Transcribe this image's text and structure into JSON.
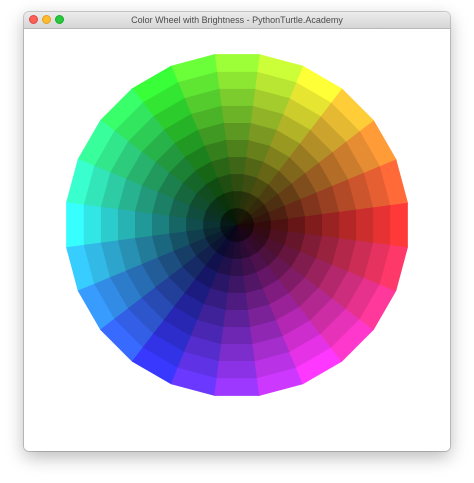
{
  "window": {
    "title": "Color Wheel with Brightness - PythonTurtle.Academy"
  },
  "title_bar_controls": {
    "close": "close-button",
    "minimize": "minimize-button",
    "maximize": "zoom-button"
  },
  "wheel": {
    "hue_segments": 24,
    "brightness_rings": 10,
    "center_color": "#000000",
    "hue_order": [
      "red",
      "orange",
      "yellow",
      "green",
      "cyan",
      "blue",
      "violet",
      "magenta"
    ],
    "background": "#ffffff"
  },
  "colors": {
    "titlebar": "#dcdcdc",
    "close": "#fc5f57",
    "minimize": "#fdbc2e",
    "maximize": "#29c840"
  }
}
